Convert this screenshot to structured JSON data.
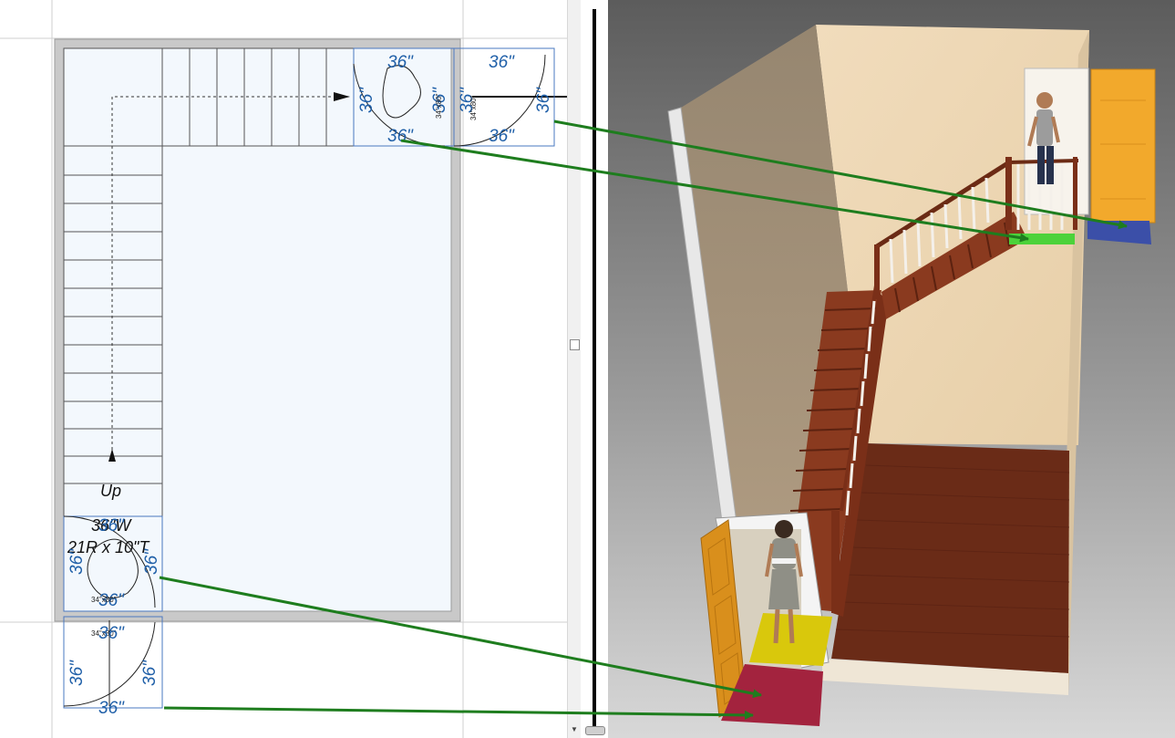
{
  "plan": {
    "stair_label": {
      "line1": "Up",
      "line2": "36\"W",
      "line3": "21R x 10\"T"
    },
    "clearance_dim": "36\"",
    "door_size": "34\"x80\""
  },
  "view3d": {
    "colors": {
      "arrow": "#1e7d1e",
      "landing_green": "#4cd23a",
      "landing_blue": "#3b4fa8",
      "entry_yellow": "#d9c80c",
      "entry_red": "#a3233e",
      "door_orange": "#f2a92c"
    }
  },
  "icons": {
    "up-arrow-icon": "triangle-up",
    "right-arrow-icon": "triangle-right"
  }
}
